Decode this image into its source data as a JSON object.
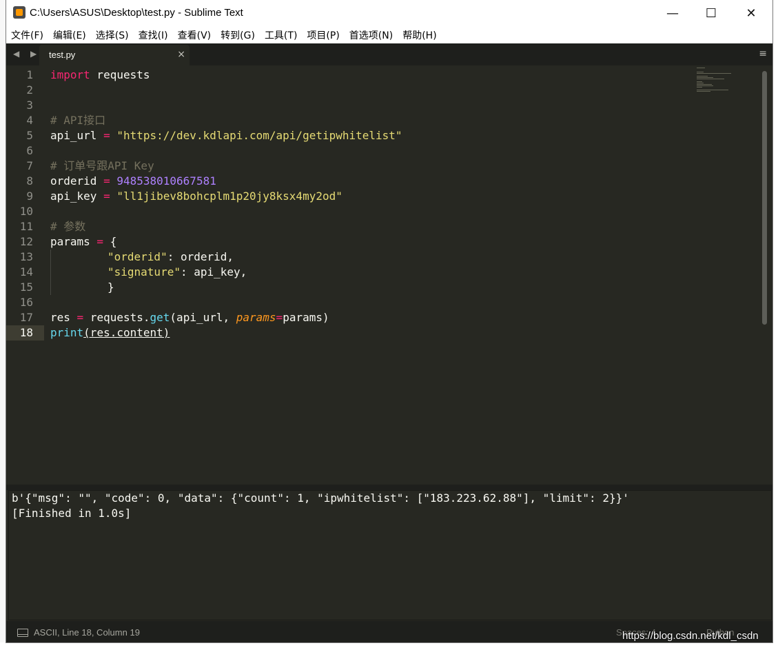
{
  "window": {
    "title": "C:\\Users\\ASUS\\Desktop\\test.py - Sublime Text",
    "minimize": "—",
    "maximize": "☐",
    "close": "✕"
  },
  "menu": [
    {
      "label": "文件(F)"
    },
    {
      "label": "编辑(E)"
    },
    {
      "label": "选择(S)"
    },
    {
      "label": "查找(I)"
    },
    {
      "label": "查看(V)"
    },
    {
      "label": "转到(G)"
    },
    {
      "label": "工具(T)"
    },
    {
      "label": "项目(P)"
    },
    {
      "label": "首选项(N)"
    },
    {
      "label": "帮助(H)"
    }
  ],
  "tabs": {
    "nav": "◀ ▶",
    "active_tab": "test.py",
    "close": "×",
    "menu": "≡"
  },
  "editor": {
    "line_numbers": [
      "1",
      "2",
      "3",
      "4",
      "5",
      "6",
      "7",
      "8",
      "9",
      "10",
      "11",
      "12",
      "13",
      "14",
      "15",
      "16",
      "17",
      "18"
    ],
    "active_line": "18",
    "code": {
      "l1_kw": "import",
      "l1_rest": " requests",
      "l4_comment": "# API接口",
      "l5_var": "api_url",
      "l5_op": " = ",
      "l5_str": "\"https://dev.kdlapi.com/api/getipwhitelist\"",
      "l7_comment": "# 订单号跟API Key",
      "l8_var": "orderid",
      "l8_op": " = ",
      "l8_num": "948538010667581",
      "l9_var": "api_key",
      "l9_op": " = ",
      "l9_str": "\"ll1jibev8bohcplm1p20jy8ksx4my2od\"",
      "l11_comment": "# 参数",
      "l12_var": "params",
      "l12_op": " = ",
      "l12_rest": "{",
      "l13_str": "\"orderid\"",
      "l13_rest": ": orderid,",
      "l14_str": "\"signature\"",
      "l14_rest": ": api_key,",
      "l15_rest": "}",
      "l17_var": "res",
      "l17_op": " = ",
      "l17_a": "requests.",
      "l17_fn": "get",
      "l17_b": "(api_url, ",
      "l17_param": "params",
      "l17_eq": "=",
      "l17_c": "params)",
      "l18_fn": "print",
      "l18_rest": "(res.content)"
    }
  },
  "output": {
    "line1": "b'{\"msg\": \"\", \"code\": 0, \"data\": {\"count\": 1, \"ipwhitelist\": [\"183.223.62.88\"], \"limit\": 2}}'",
    "line2": "[Finished in 1.0s]"
  },
  "status": {
    "position": "ASCII, Line 18, Column 19",
    "spaces": "Spaces: 4",
    "syntax": "Python"
  },
  "watermark": "https://blog.csdn.net/kdl_csdn",
  "colors": {
    "background": "#272822",
    "keyword": "#f92672",
    "string": "#e6db74",
    "comment": "#75715e",
    "number": "#ae81ff",
    "function": "#66d9ef",
    "parameter": "#fd971f"
  }
}
